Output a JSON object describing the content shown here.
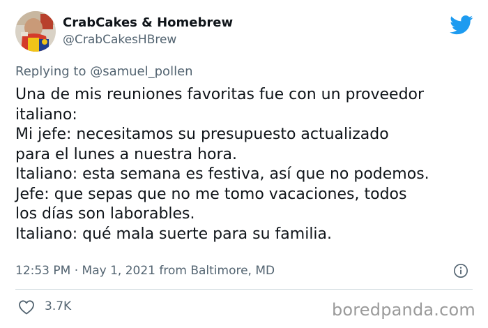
{
  "author": {
    "display_name": "CrabCakes & Homebrew",
    "handle": "@CrabCakesHBrew",
    "avatar": "avatar-image"
  },
  "reply": {
    "text": "Replying to @samuel_pollen"
  },
  "tweet": {
    "lines": [
      "Una de mis reuniones favoritas fue con un proveedor",
      "italiano:",
      "Mi jefe: necesitamos su presupuesto actualizado",
      "para el lunes a nuestra hora.",
      "Italiano: esta semana es festiva, así que no podemos.",
      "Jefe: que sepas que no me tomo vacaciones, todos",
      "los días son laborables.",
      "Italiano: qué mala suerte para su familia."
    ]
  },
  "meta": {
    "text": "12:53 PM · May 1, 2021 from Baltimore, MD"
  },
  "stats": {
    "likes": "3.7K"
  },
  "watermark": {
    "text": "boredpanda.com"
  },
  "icons": {
    "logo": "twitter-bird-icon",
    "info": "info-icon",
    "like": "heart-icon"
  },
  "colors": {
    "twitter_blue": "#1d9bf0",
    "text_primary": "#0f1419",
    "text_secondary": "#536471",
    "divider": "#cfd9de"
  }
}
